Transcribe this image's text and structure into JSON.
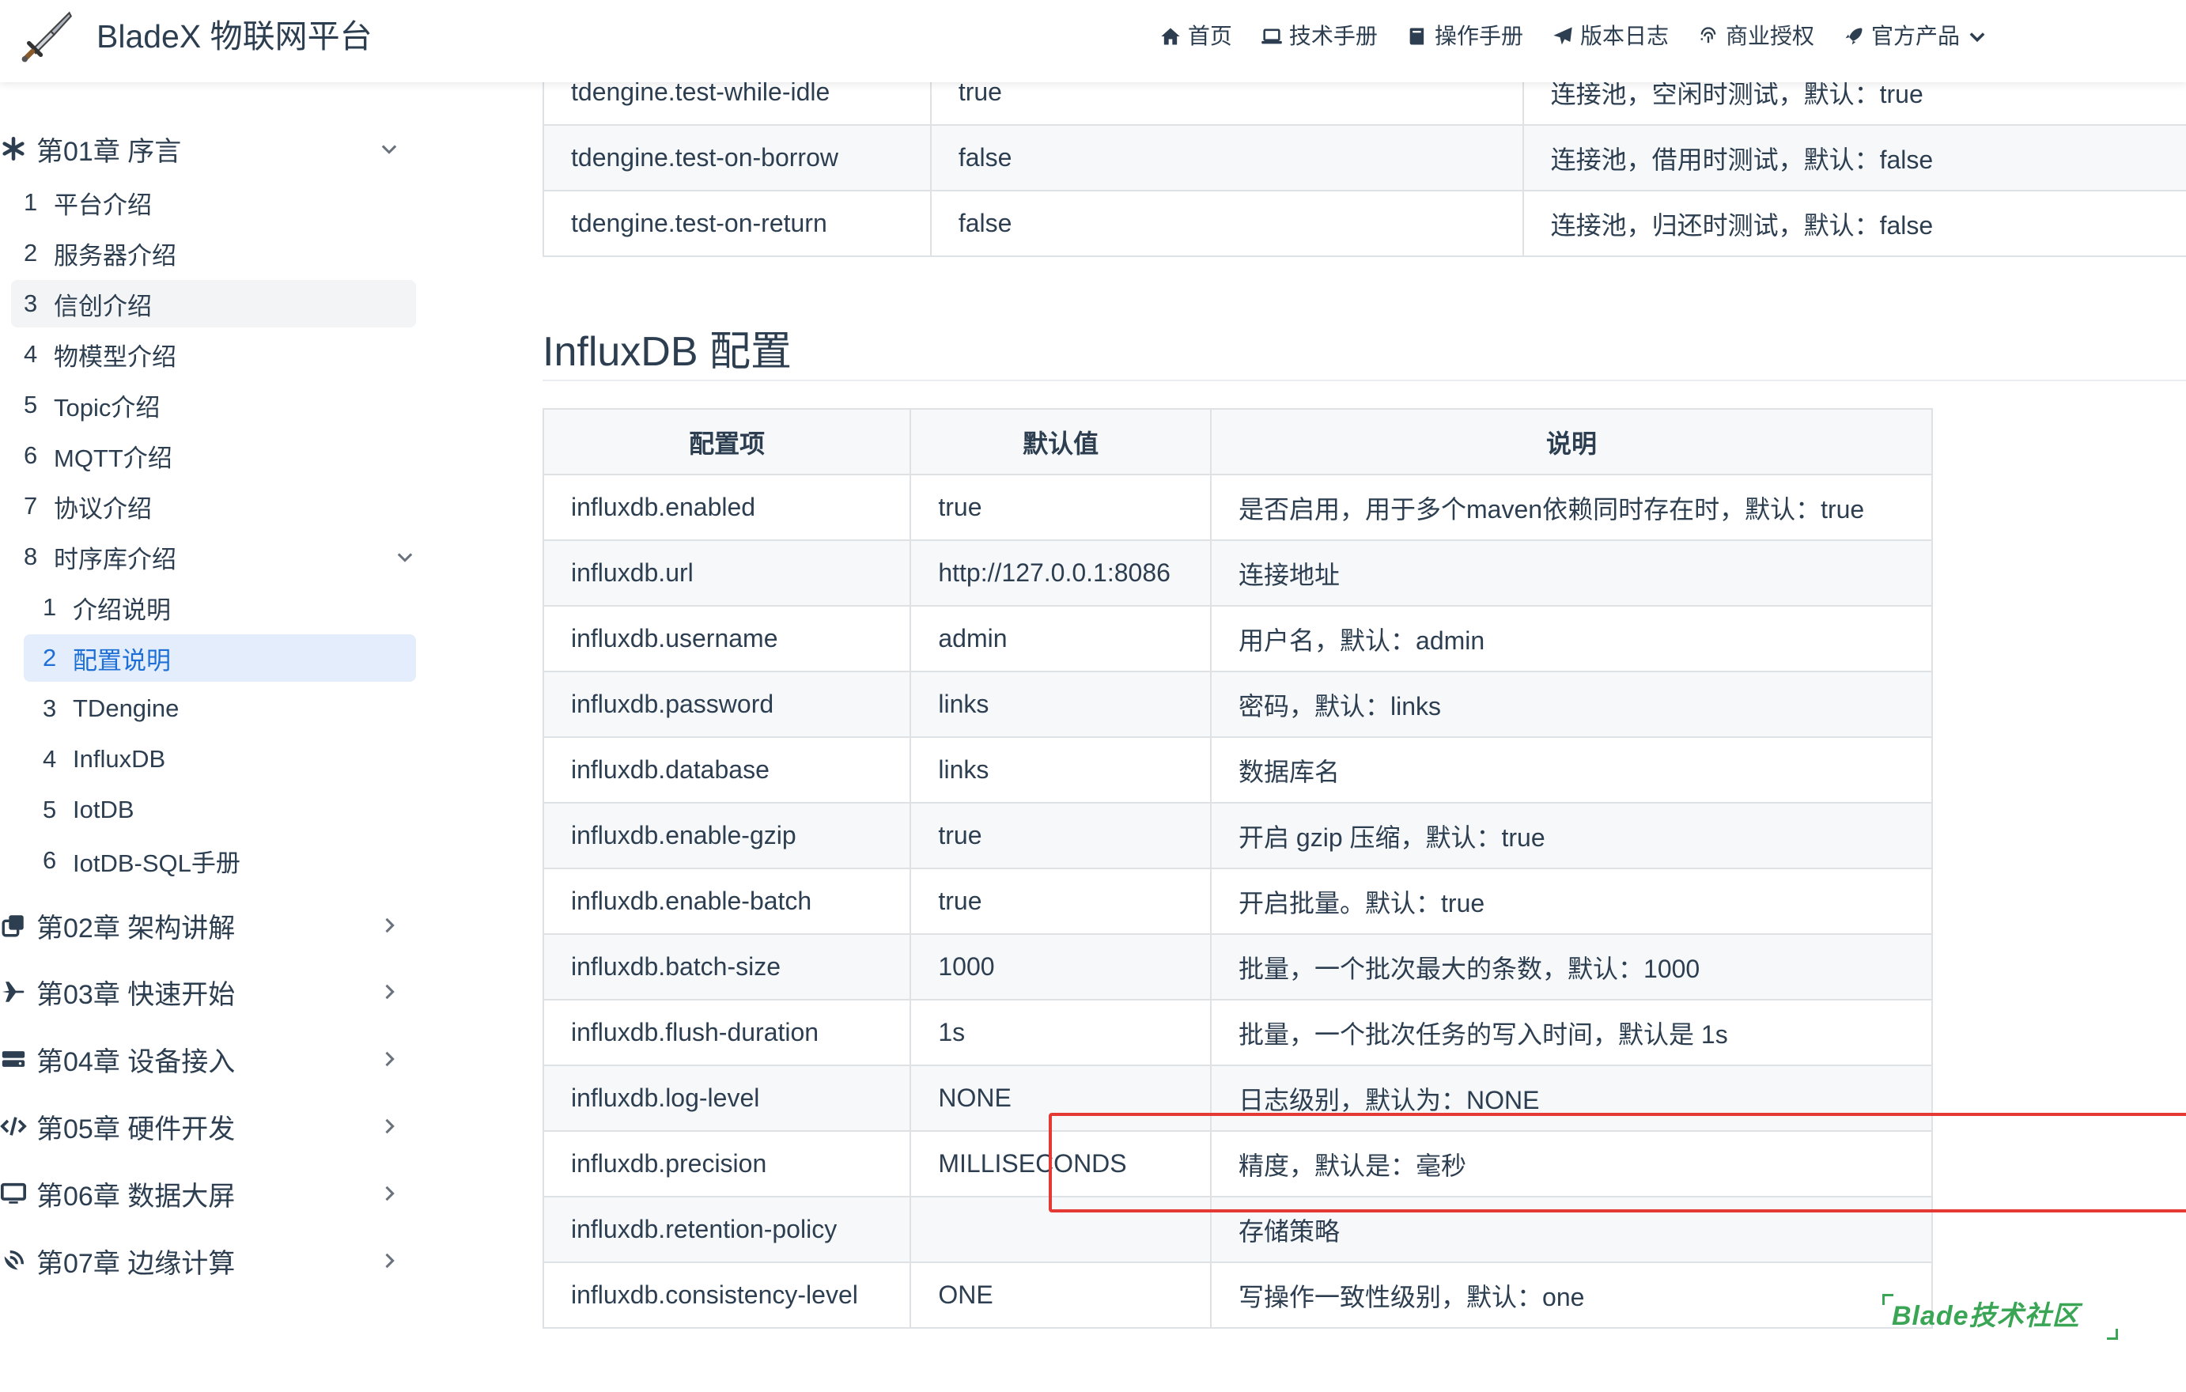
{
  "header": {
    "brand": "BladeX 物联网平台",
    "nav": [
      {
        "label": "首页",
        "icon": "home-icon"
      },
      {
        "label": "技术手册",
        "icon": "laptop-icon"
      },
      {
        "label": "操作手册",
        "icon": "book-icon"
      },
      {
        "label": "版本日志",
        "icon": "paper-plane-icon"
      },
      {
        "label": "商业授权",
        "icon": "fingerprint-icon"
      },
      {
        "label": "官方产品",
        "icon": "rocket-icon"
      }
    ]
  },
  "sidebar": {
    "chapter01": "第01章 序言",
    "items": [
      {
        "num": "1",
        "label": "平台介绍"
      },
      {
        "num": "2",
        "label": "服务器介绍"
      },
      {
        "num": "3",
        "label": "信创介绍"
      },
      {
        "num": "4",
        "label": "物模型介绍"
      },
      {
        "num": "5",
        "label": "Topic介绍"
      },
      {
        "num": "6",
        "label": "MQTT介绍"
      },
      {
        "num": "7",
        "label": "协议介绍"
      },
      {
        "num": "8",
        "label": "时序库介绍"
      }
    ],
    "subitems": [
      {
        "num": "1",
        "label": "介绍说明"
      },
      {
        "num": "2",
        "label": "配置说明"
      },
      {
        "num": "3",
        "label": "TDengine"
      },
      {
        "num": "4",
        "label": "InfluxDB"
      },
      {
        "num": "5",
        "label": "IotDB"
      },
      {
        "num": "6",
        "label": "IotDB-SQL手册"
      }
    ],
    "chapters": [
      {
        "label": "第02章 架构讲解",
        "icon": "clone-icon"
      },
      {
        "label": "第03章 快速开始",
        "icon": "plane-icon"
      },
      {
        "label": "第04章 设备接入",
        "icon": "hdd-icon"
      },
      {
        "label": "第05章 硬件开发",
        "icon": "code-icon"
      },
      {
        "label": "第06章 数据大屏",
        "icon": "desktop-icon"
      },
      {
        "label": "第07章 边缘计算",
        "icon": "satellite-dish-icon"
      }
    ]
  },
  "top_table": {
    "rows": [
      [
        "tdengine.test-while-idle",
        "true",
        "连接池，空闲时测试，默认：true"
      ],
      [
        "tdengine.test-on-borrow",
        "false",
        "连接池，借用时测试，默认：false"
      ],
      [
        "tdengine.test-on-return",
        "false",
        "连接池，归还时测试，默认：false"
      ]
    ]
  },
  "section": {
    "title": "InfluxDB 配置"
  },
  "main_table": {
    "headers": [
      "配置项",
      "默认值",
      "说明"
    ],
    "rows": [
      [
        "influxdb.enabled",
        "true",
        "是否启用，用于多个maven依赖同时存在时，默认：true"
      ],
      [
        "influxdb.url",
        "http://127.0.0.1:8086",
        "连接地址"
      ],
      [
        "influxdb.username",
        "admin",
        "用户名，默认：admin"
      ],
      [
        "influxdb.password",
        "links",
        "密码，默认：links"
      ],
      [
        "influxdb.database",
        "links",
        "数据库名"
      ],
      [
        "influxdb.enable-gzip",
        "true",
        "开启 gzip 压缩，默认：true"
      ],
      [
        "influxdb.enable-batch",
        "true",
        "开启批量。默认：true"
      ],
      [
        "influxdb.batch-size",
        "1000",
        "批量，一个批次最大的条数，默认：1000"
      ],
      [
        "influxdb.flush-duration",
        "1s",
        "批量，一个批次任务的写入时间，默认是 1s"
      ],
      [
        "influxdb.log-level",
        "NONE",
        "日志级别，默认为：NONE"
      ],
      [
        "influxdb.precision",
        "MILLISECONDS",
        "精度，默认是：毫秒"
      ],
      [
        "influxdb.retention-policy",
        "",
        "存储策略"
      ],
      [
        "influxdb.consistency-level",
        "ONE",
        "写操作一致性级别，默认：one"
      ]
    ]
  },
  "watermark": "Blade技术社区",
  "colors": {
    "highlight": "#e53935",
    "active": "#1d6fd6",
    "watermark": "#3aa655"
  }
}
